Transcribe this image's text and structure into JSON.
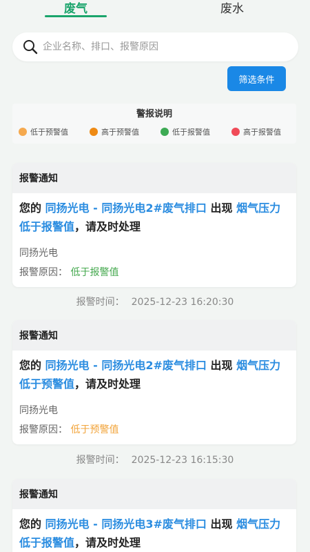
{
  "tabs": [
    {
      "label": "废气",
      "active": true
    },
    {
      "label": "废水",
      "active": false
    }
  ],
  "search": {
    "placeholder": "企业名称、排口、报警原因",
    "value": ""
  },
  "filter_button": "筛选条件",
  "legend": {
    "title": "警报说明",
    "items": [
      {
        "label": "低于预警值",
        "color": "#f5a94e"
      },
      {
        "label": "高于预警值",
        "color": "#ee8a14"
      },
      {
        "label": "低于报警值",
        "color": "#3daa54"
      },
      {
        "label": "高于报警值",
        "color": "#f04b58"
      }
    ]
  },
  "alerts": [
    {
      "header": "报警通知",
      "prefix": "您的",
      "source": "同扬光电 - 同扬光电2#废气排口",
      "middle": "出现",
      "condition": "烟气压力低于报警值",
      "suffix": "，请及时处理",
      "company": "同扬光电",
      "reason_label": "报警原因：",
      "reason": "低于报警值",
      "time_label": "报警时间：",
      "time": "2025-12-23 16:20:30"
    },
    {
      "header": "报警通知",
      "prefix": "您的",
      "source": "同扬光电 - 同扬光电2#废气排口",
      "middle": "出现",
      "condition": "烟气压力低于预警值",
      "suffix": "，请及时处理",
      "company": "同扬光电",
      "reason_label": "报警原因：",
      "reason": "低于预警值",
      "time_label": "报警时间：",
      "time": "2025-12-23 16:15:30"
    },
    {
      "header": "报警通知",
      "prefix": "您的",
      "source": "同扬光电 - 同扬光电3#废气排口",
      "middle": "出现",
      "condition": "烟气压力低于报警值",
      "suffix": "，请及时处理"
    }
  ]
}
